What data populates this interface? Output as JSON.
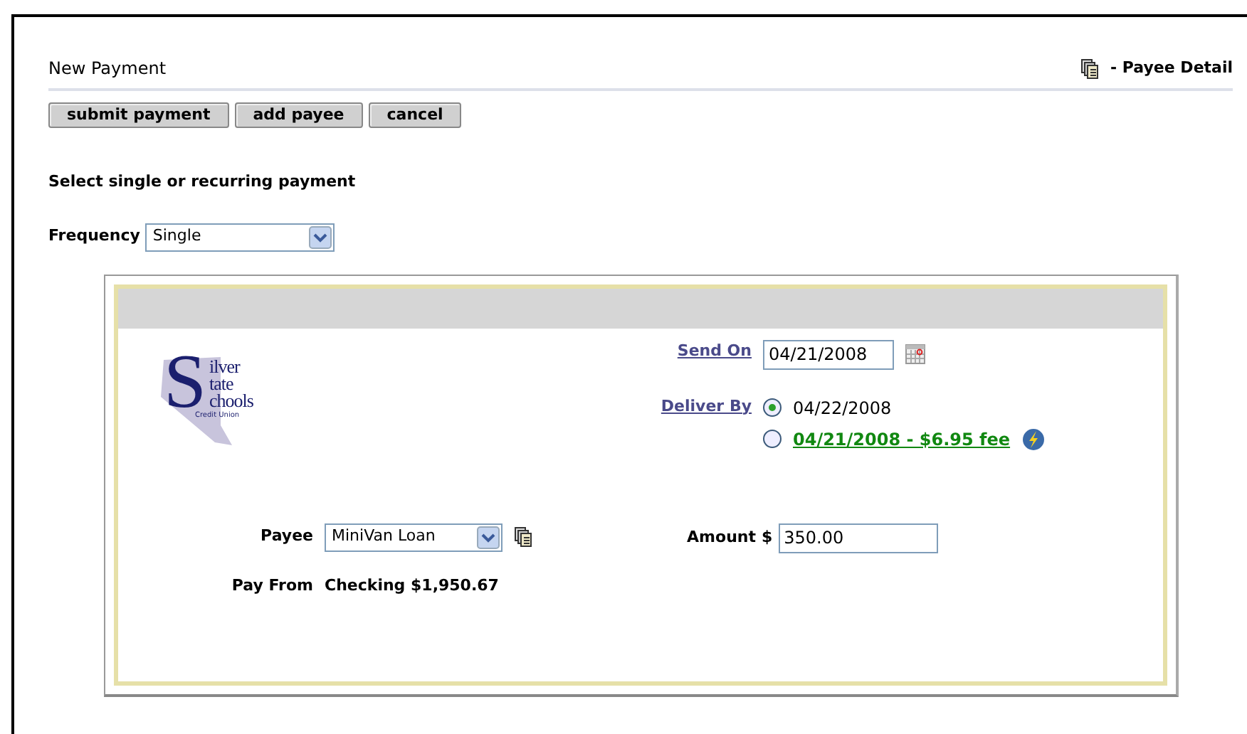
{
  "page": {
    "title": "New Payment",
    "detail_link": "- Payee Detail"
  },
  "buttons": [
    "submit payment",
    "add payee",
    "cancel"
  ],
  "section_heading": "Select single or recurring payment",
  "frequency": {
    "label": "Frequency",
    "value": "Single"
  },
  "logo": {
    "initial": "S",
    "lines": [
      "ilver",
      "tate",
      "chools"
    ],
    "tagline": "Credit Union"
  },
  "send_on": {
    "label": "Send On",
    "value": "04/21/2008"
  },
  "deliver_by": {
    "label": "Deliver By",
    "options": [
      {
        "text": "04/22/2008",
        "kind": "standard",
        "selected": true
      },
      {
        "text": "04/21/2008 - $6.95 fee",
        "kind": "expedited",
        "selected": false
      }
    ]
  },
  "payee": {
    "label": "Payee",
    "value": "MiniVan Loan"
  },
  "pay_from": {
    "label": "Pay From",
    "value": "Checking $1,950.67"
  },
  "amount": {
    "label": "Amount",
    "currency": "$",
    "value": "350.00"
  }
}
